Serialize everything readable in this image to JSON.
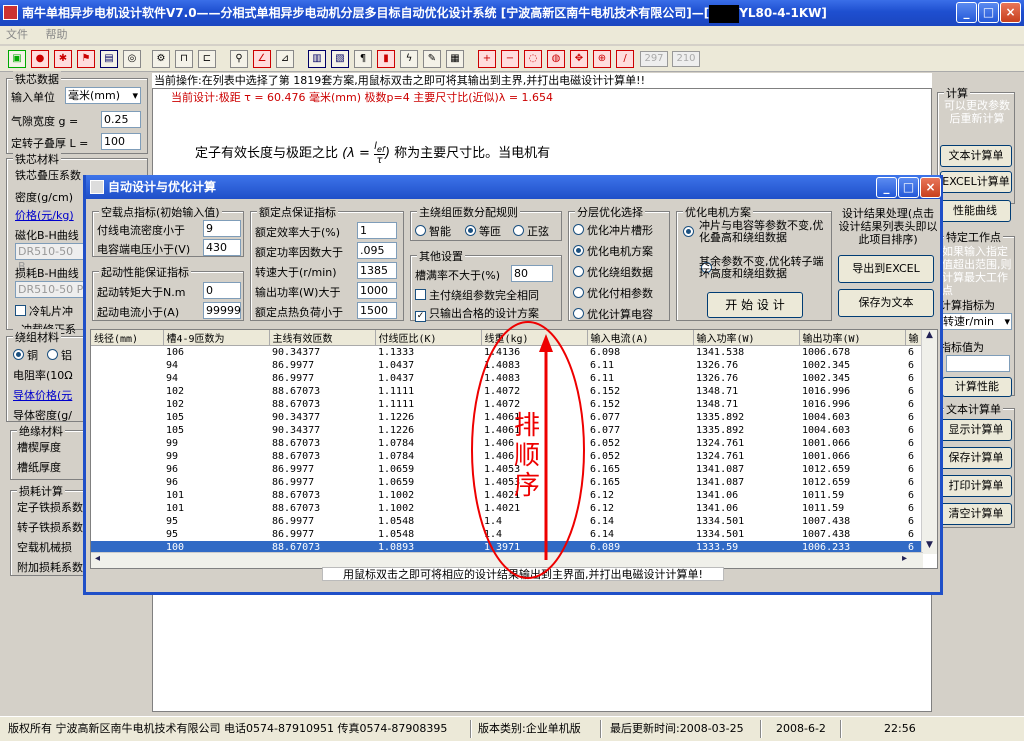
{
  "window": {
    "title": "南牛单相异步电机设计软件V7.0——分相式单相异步电动机分层多目标自动优化设计系统  [宁波高新区南牛电机技术有限公司]—[",
    "title_suffix": "YL80-4-1KW]",
    "minimize": "_",
    "maximize": "□",
    "close": "×"
  },
  "menu": [
    "文件",
    "帮助"
  ],
  "toolbar": {
    "field1": "297",
    "field2": "210"
  },
  "left_panel": {
    "core_group": "铁芯数据",
    "unit_label": "输入单位",
    "unit_value": "毫米(mm)",
    "gap_label": "气隙宽度    g =",
    "gap_value": "0.25",
    "rotor_len_label": "定转子叠厚 L =",
    "rotor_len_value": "100",
    "material_group": "铁芯材料",
    "stack_label": "铁芯叠压系数",
    "stack_value": "0.95",
    "density_label": "密度(g/cm)",
    "price_label": "价格(元/kg)",
    "bh_label": "磁化B-H曲线",
    "bh_value": "DR510-50 B",
    "loss_label": "损耗B-H曲线",
    "loss_value": "DR510-50 P",
    "cold_label": "冷轧片冲",
    "punch_label": "冲载修正系",
    "winding_group": "绕组材料",
    "copper": "铜",
    "alu": "铝",
    "resist_label": "电阻率(10Ω",
    "cond_price": "导体价格(元",
    "cond_density": "导体密度(g/",
    "insul_group": "绝缘材料",
    "slot_thick": "槽楔厚度",
    "slot_paper": "槽纸厚度",
    "loss_group": "损耗计算",
    "stator_loss": "定子铁损系数",
    "rotor_loss": "转子铁损系数",
    "mech_loss": "空载机械损",
    "add_loss": "附加损耗系数"
  },
  "info": {
    "line1": "当前操作:在列表中选择了第 1819套方案,用鼠标双击之即可将其输出到主界,并打出电磁设计计算单!!",
    "line2": "当前设计:极距 τ = 60.476 毫米(mm)    极数p=4    主要尺寸比(近似)λ = 1.654",
    "doc_text_a": "定子有效长度与极距之比",
    "formula_l": "λ =",
    "formula_num": "l",
    "formula_num_sub": "ef",
    "formula_den": "τ",
    "doc_text_b": "称为主要尺寸比。当电机有"
  },
  "right_panel": {
    "calc_group": "计算",
    "calc_note": "可以更改参数后重新计算",
    "text_calc": "文本计算单",
    "excel_calc": "EXCEL计算单",
    "perf_curve": "性能曲线",
    "point_group": "特定工作点",
    "point_note": "如果输入指定值超出范围,则计算最大工作点",
    "calc_by": "计算指标为",
    "calc_by_value": "转速r/min",
    "value_label": "指标值为",
    "calc_perf": "计算性能",
    "text_group": "文本计算单",
    "show_calc": "显示计算单",
    "save_calc": "保存计算单",
    "print_calc": "打印计算单",
    "clear_calc": "清空计算单"
  },
  "dialog": {
    "title": "自动设计与优化计算",
    "noload_group": "空载点指标(初始输入值)",
    "cur_density_label": "付线电流密度小于",
    "cur_density_value": "9",
    "cap_volt_label": "电容端电压小于(V)",
    "cap_volt_value": "430",
    "start_group": "起动性能保证指标",
    "start_torque_label": "起动转矩大于N.m",
    "start_torque_value": "0",
    "start_current_label": "起动电流小于(A)",
    "start_current_value": "99999",
    "rated_group": "额定点保证指标",
    "eff_label": "额定效率大于(%)",
    "eff_value": "1",
    "pf_label": "额定功率因数大于",
    "pf_value": ".095",
    "speed_label": "转速大于(r/min)",
    "speed_value": "1385",
    "out_label": "输出功率(W)大于",
    "out_value": "1000",
    "heat_label": "额定点热负荷小于",
    "heat_value": "1500",
    "turns_group": "主绕组匝数分配规则",
    "smart": "智能",
    "equal": "等匝",
    "sine": "正弦",
    "other_group": "其他设置",
    "slotfill_label": "槽满率不大于(%)",
    "slotfill_value": "80",
    "same_param": "主付绕组参数完全相同",
    "only_ok": "只输出合格的设计方案",
    "layer_group": "分层优化选择",
    "opt1": "优化冲片槽形",
    "opt2": "优化电机方案",
    "opt3": "优化绕组数据",
    "opt4": "优化付相参数",
    "opt5": "优化计算电容",
    "motor_group": "优化电机方案",
    "motor_a": "冲片与电容等参数不变,优化叠高和绕组数据",
    "motor_b": "其余参数不变,优化转子端环高度和绕组数据",
    "start_btn": "开 始 设 计",
    "result_note": "设计结果处理(点击设计结果列表头即以此项目排序)",
    "export_excel": "导出到EXCEL",
    "save_text": "保存为文本",
    "hint": "用鼠标双击之即可将相应的设计结果输出到主界面,并打出电磁设计计算单!",
    "annotation": "排顺序",
    "columns": [
      "线径(mm)",
      "槽4-9匝数为",
      "主线有效匝数",
      "付线匝比(K)",
      "线重(kg)",
      "输入电流(A)",
      "输入功率(W)",
      "输出功率(W)",
      "输"
    ],
    "rows": [
      [
        "",
        "106",
        "90.34377",
        "1.1333",
        "1.4136",
        "6.098",
        "1341.538",
        "1006.678",
        "6"
      ],
      [
        "",
        "94",
        "86.9977",
        "1.0437",
        "1.4083",
        "6.11",
        "1326.76",
        "1002.345",
        "6"
      ],
      [
        "",
        "94",
        "86.9977",
        "1.0437",
        "1.4083",
        "6.11",
        "1326.76",
        "1002.345",
        "6"
      ],
      [
        "",
        "102",
        "88.67073",
        "1.1111",
        "1.4072",
        "6.152",
        "1348.71",
        "1016.996",
        "6"
      ],
      [
        "",
        "102",
        "88.67073",
        "1.1111",
        "1.4072",
        "6.152",
        "1348.71",
        "1016.996",
        "6"
      ],
      [
        "",
        "105",
        "90.34377",
        "1.1226",
        "1.4061",
        "6.077",
        "1335.892",
        "1004.603",
        "6"
      ],
      [
        "",
        "105",
        "90.34377",
        "1.1226",
        "1.4061",
        "6.077",
        "1335.892",
        "1004.603",
        "6"
      ],
      [
        "",
        "99",
        "88.67073",
        "1.0784",
        "1.406",
        "6.052",
        "1324.761",
        "1001.066",
        "6"
      ],
      [
        "",
        "99",
        "88.67073",
        "1.0784",
        "1.406",
        "6.052",
        "1324.761",
        "1001.066",
        "6"
      ],
      [
        "",
        "96",
        "86.9977",
        "1.0659",
        "1.4053",
        "6.165",
        "1341.087",
        "1012.659",
        "6"
      ],
      [
        "",
        "96",
        "86.9977",
        "1.0659",
        "1.4053",
        "6.165",
        "1341.087",
        "1012.659",
        "6"
      ],
      [
        "",
        "101",
        "88.67073",
        "1.1002",
        "1.4021",
        "6.12",
        "1341.06",
        "1011.59",
        "6"
      ],
      [
        "",
        "101",
        "88.67073",
        "1.1002",
        "1.4021",
        "6.12",
        "1341.06",
        "1011.59",
        "6"
      ],
      [
        "",
        "95",
        "86.9977",
        "1.0548",
        "1.4",
        "6.14",
        "1334.501",
        "1007.438",
        "6"
      ],
      [
        "",
        "95",
        "86.9977",
        "1.0548",
        "1.4",
        "6.14",
        "1334.501",
        "1007.438",
        "6"
      ],
      [
        "",
        "100",
        "88.67073",
        "1.0893",
        "1.3971",
        "6.089",
        "1333.59",
        "1006.233",
        "6"
      ],
      [
        "",
        "100",
        "88.67073",
        "1.0893",
        "1.3971",
        "6.089",
        "1333.59",
        "1006.233",
        "6"
      ]
    ]
  },
  "status": {
    "owner": "版权所有  宁波高新区南牛电机技术有限公司  电话0574-87910951 传真0574-87908395",
    "edition": "版本类别:企业单机版",
    "updated": "最后更新时间:2008-03-25",
    "date": "2008-6-2",
    "time": "22:56"
  }
}
